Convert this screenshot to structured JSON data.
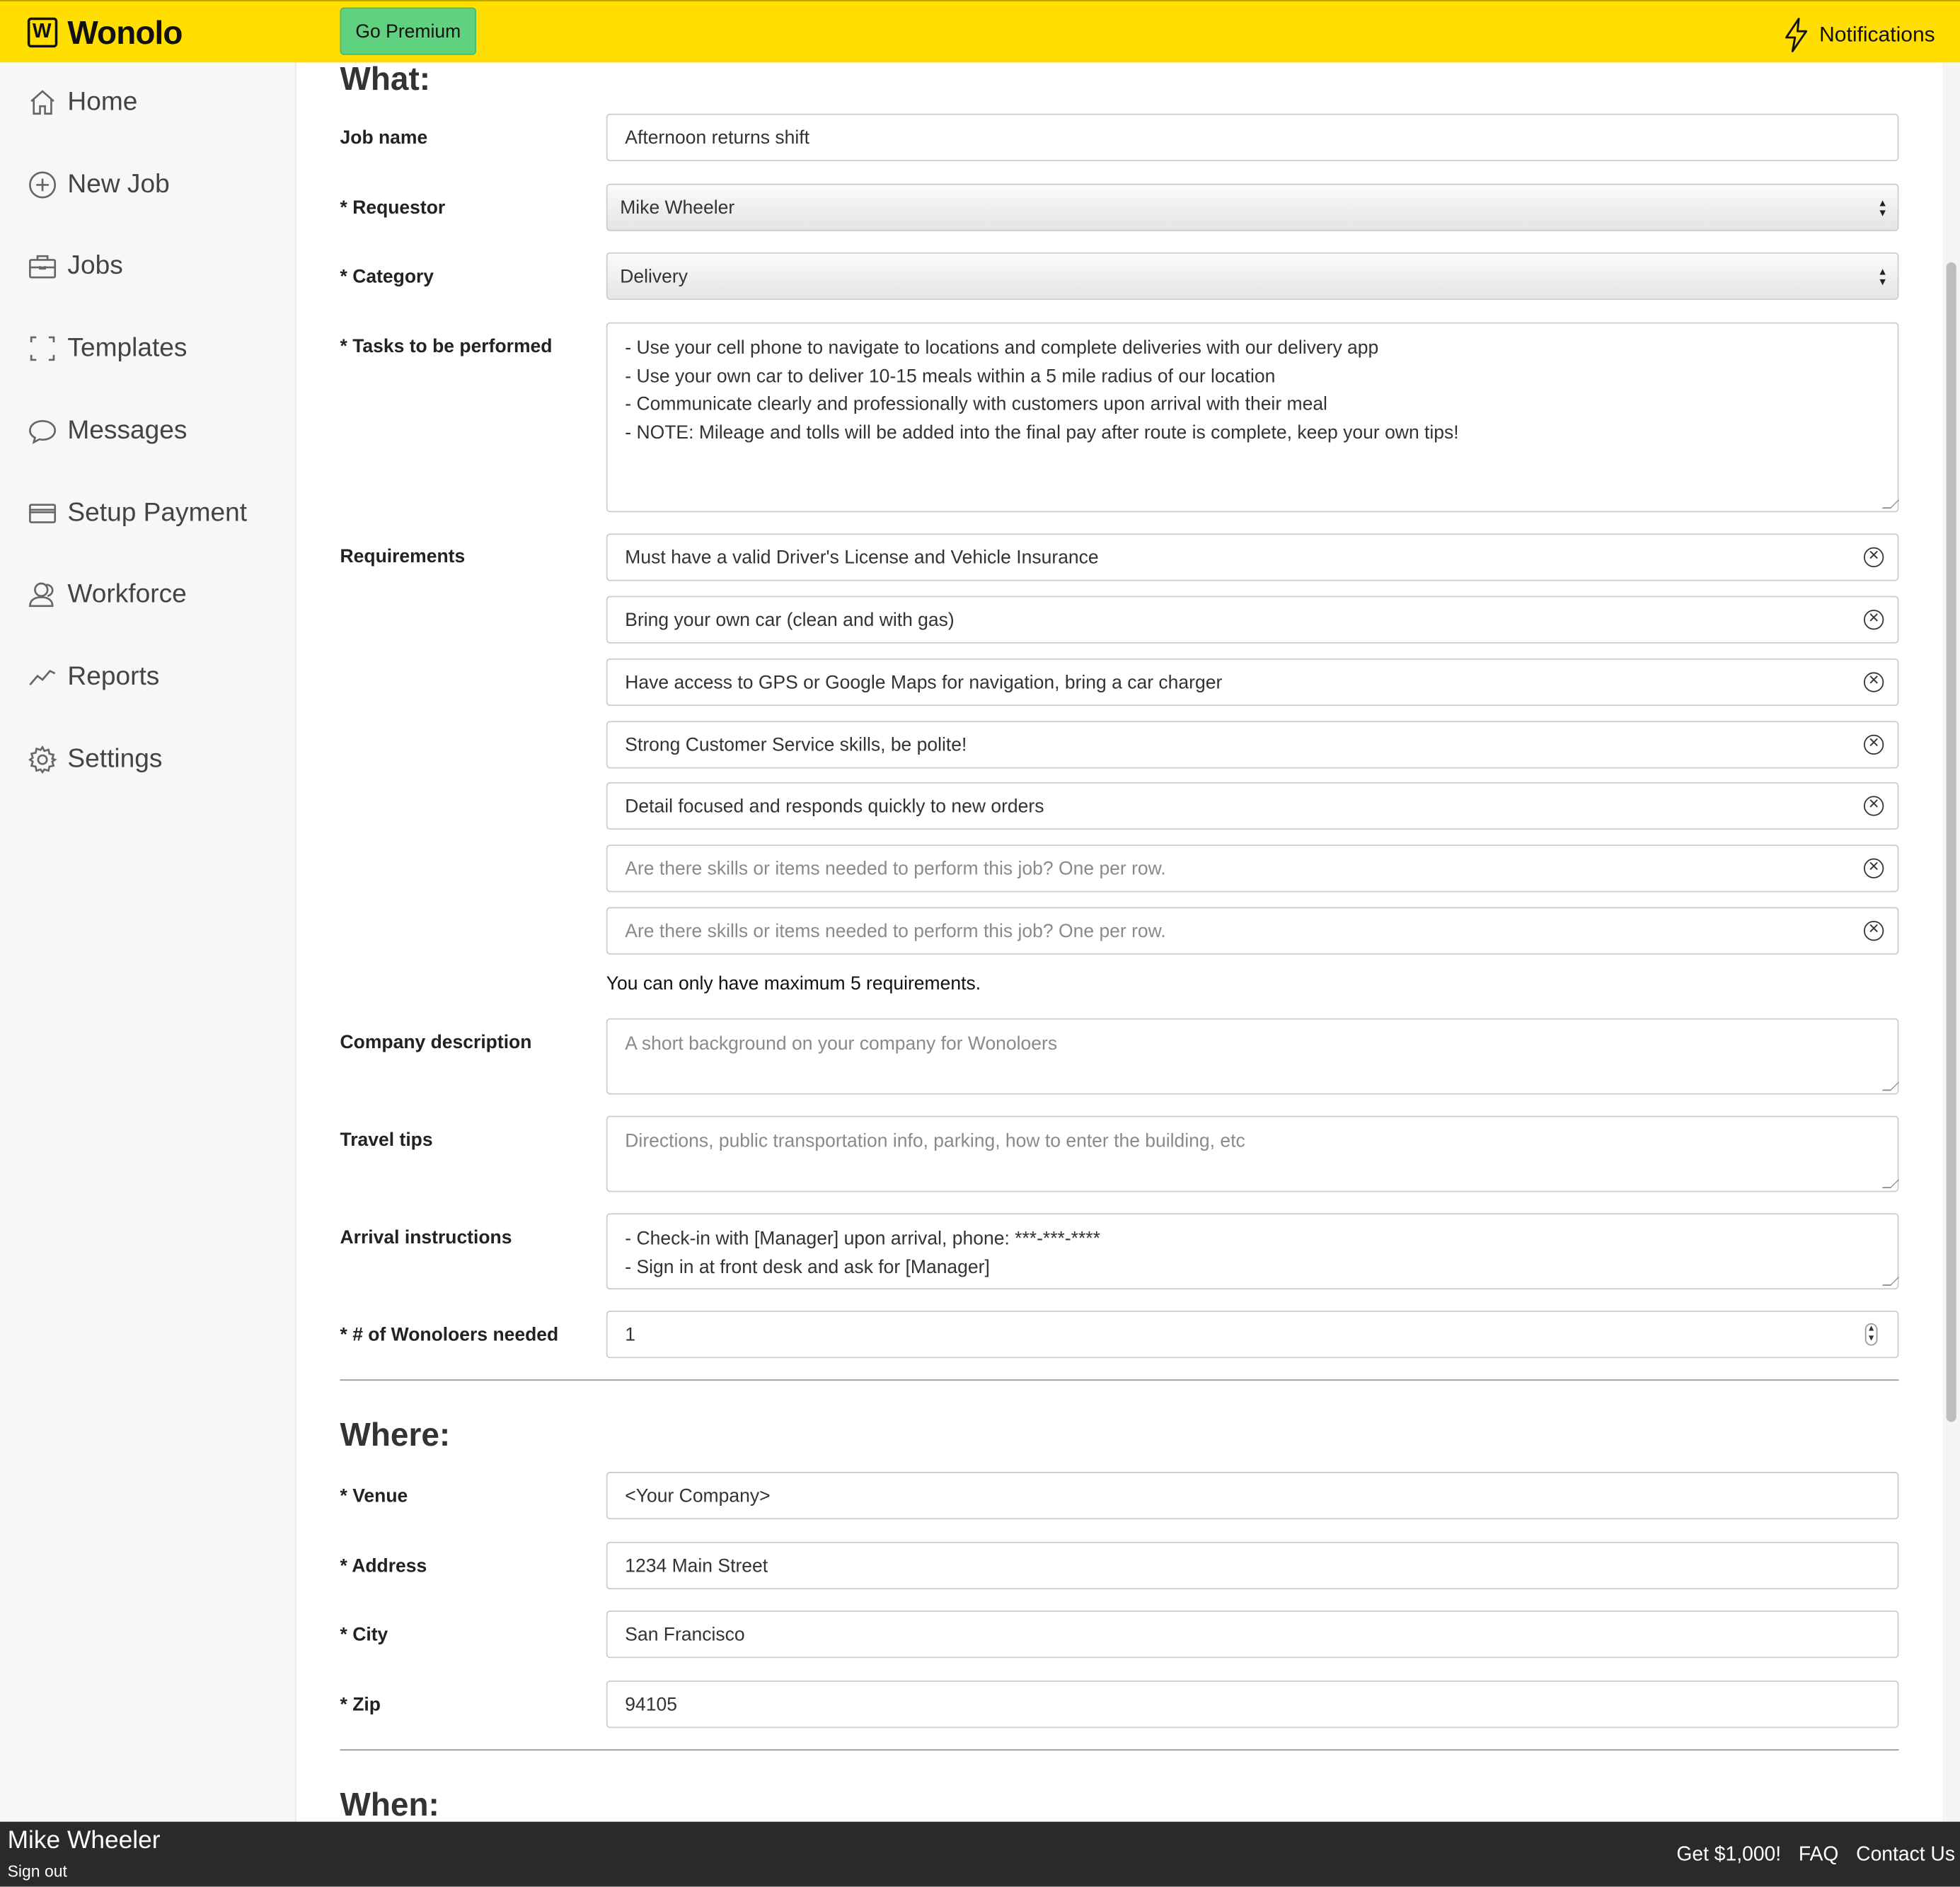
{
  "header": {
    "brand": "Wonolo",
    "premium_label": "Go Premium",
    "notifications_label": "Notifications",
    "brand_color": "#ffde00",
    "premium_color": "#5fd17f"
  },
  "sidebar": {
    "items": [
      {
        "label": "Home",
        "icon": "home-icon"
      },
      {
        "label": "New Job",
        "icon": "plus-circle-icon"
      },
      {
        "label": "Jobs",
        "icon": "briefcase-icon"
      },
      {
        "label": "Templates",
        "icon": "template-icon"
      },
      {
        "label": "Messages",
        "icon": "chat-bubble-icon"
      },
      {
        "label": "Setup Payment",
        "icon": "credit-card-icon"
      },
      {
        "label": "Workforce",
        "icon": "users-icon"
      },
      {
        "label": "Reports",
        "icon": "trend-chart-icon"
      },
      {
        "label": "Settings",
        "icon": "gear-icon"
      }
    ]
  },
  "what": {
    "title": "What:",
    "job_name": {
      "label": "Job name",
      "value": "Afternoon returns shift"
    },
    "requestor": {
      "label": "* Requestor",
      "value": "Mike Wheeler"
    },
    "category": {
      "label": "* Category",
      "value": "Delivery"
    },
    "tasks": {
      "label": "* Tasks to be performed",
      "value": "- Use your cell phone to navigate to locations and complete deliveries with our delivery app\n- Use your own car to deliver 10-15 meals within a 5 mile radius of our location\n- Communicate clearly and professionally with customers upon arrival with their meal\n- NOTE: Mileage and tolls will be added into the final pay after route is complete, keep your own tips!"
    },
    "requirements": {
      "label": "Requirements",
      "items": [
        "Must have a valid Driver's License and Vehicle Insurance",
        "Bring your own car (clean and with gas)",
        "Have access to GPS or Google Maps for navigation, bring a car charger",
        "Strong Customer Service skills, be polite!",
        "Detail focused and responds quickly to new orders"
      ],
      "placeholder": "Are there skills or items needed to perform this job? One per row.",
      "note": "You can only have maximum 5 requirements."
    },
    "company_description": {
      "label": "Company description",
      "placeholder": "A short background on your company for Wonoloers"
    },
    "travel_tips": {
      "label": "Travel tips",
      "placeholder": "Directions, public transportation info, parking, how to enter the building, etc"
    },
    "arrival": {
      "label": "Arrival instructions",
      "value": "- Check-in with [Manager] upon arrival, phone: ***-***-****\n- Sign in at front desk and ask for [Manager]"
    },
    "wonoloers": {
      "label": "* # of Wonoloers needed",
      "value": "1"
    }
  },
  "where": {
    "title": "Where:",
    "venue": {
      "label": "* Venue",
      "value": "<Your Company>"
    },
    "address": {
      "label": "* Address",
      "value": "1234 Main Street"
    },
    "city": {
      "label": "* City",
      "value": "San Francisco"
    },
    "zip": {
      "label": "* Zip",
      "value": "94105"
    }
  },
  "when": {
    "title": "When:"
  },
  "footer": {
    "user_name": "Mike Wheeler",
    "sign_out": "Sign out",
    "links": [
      "Get $1,000!",
      "FAQ",
      "Contact Us"
    ]
  }
}
